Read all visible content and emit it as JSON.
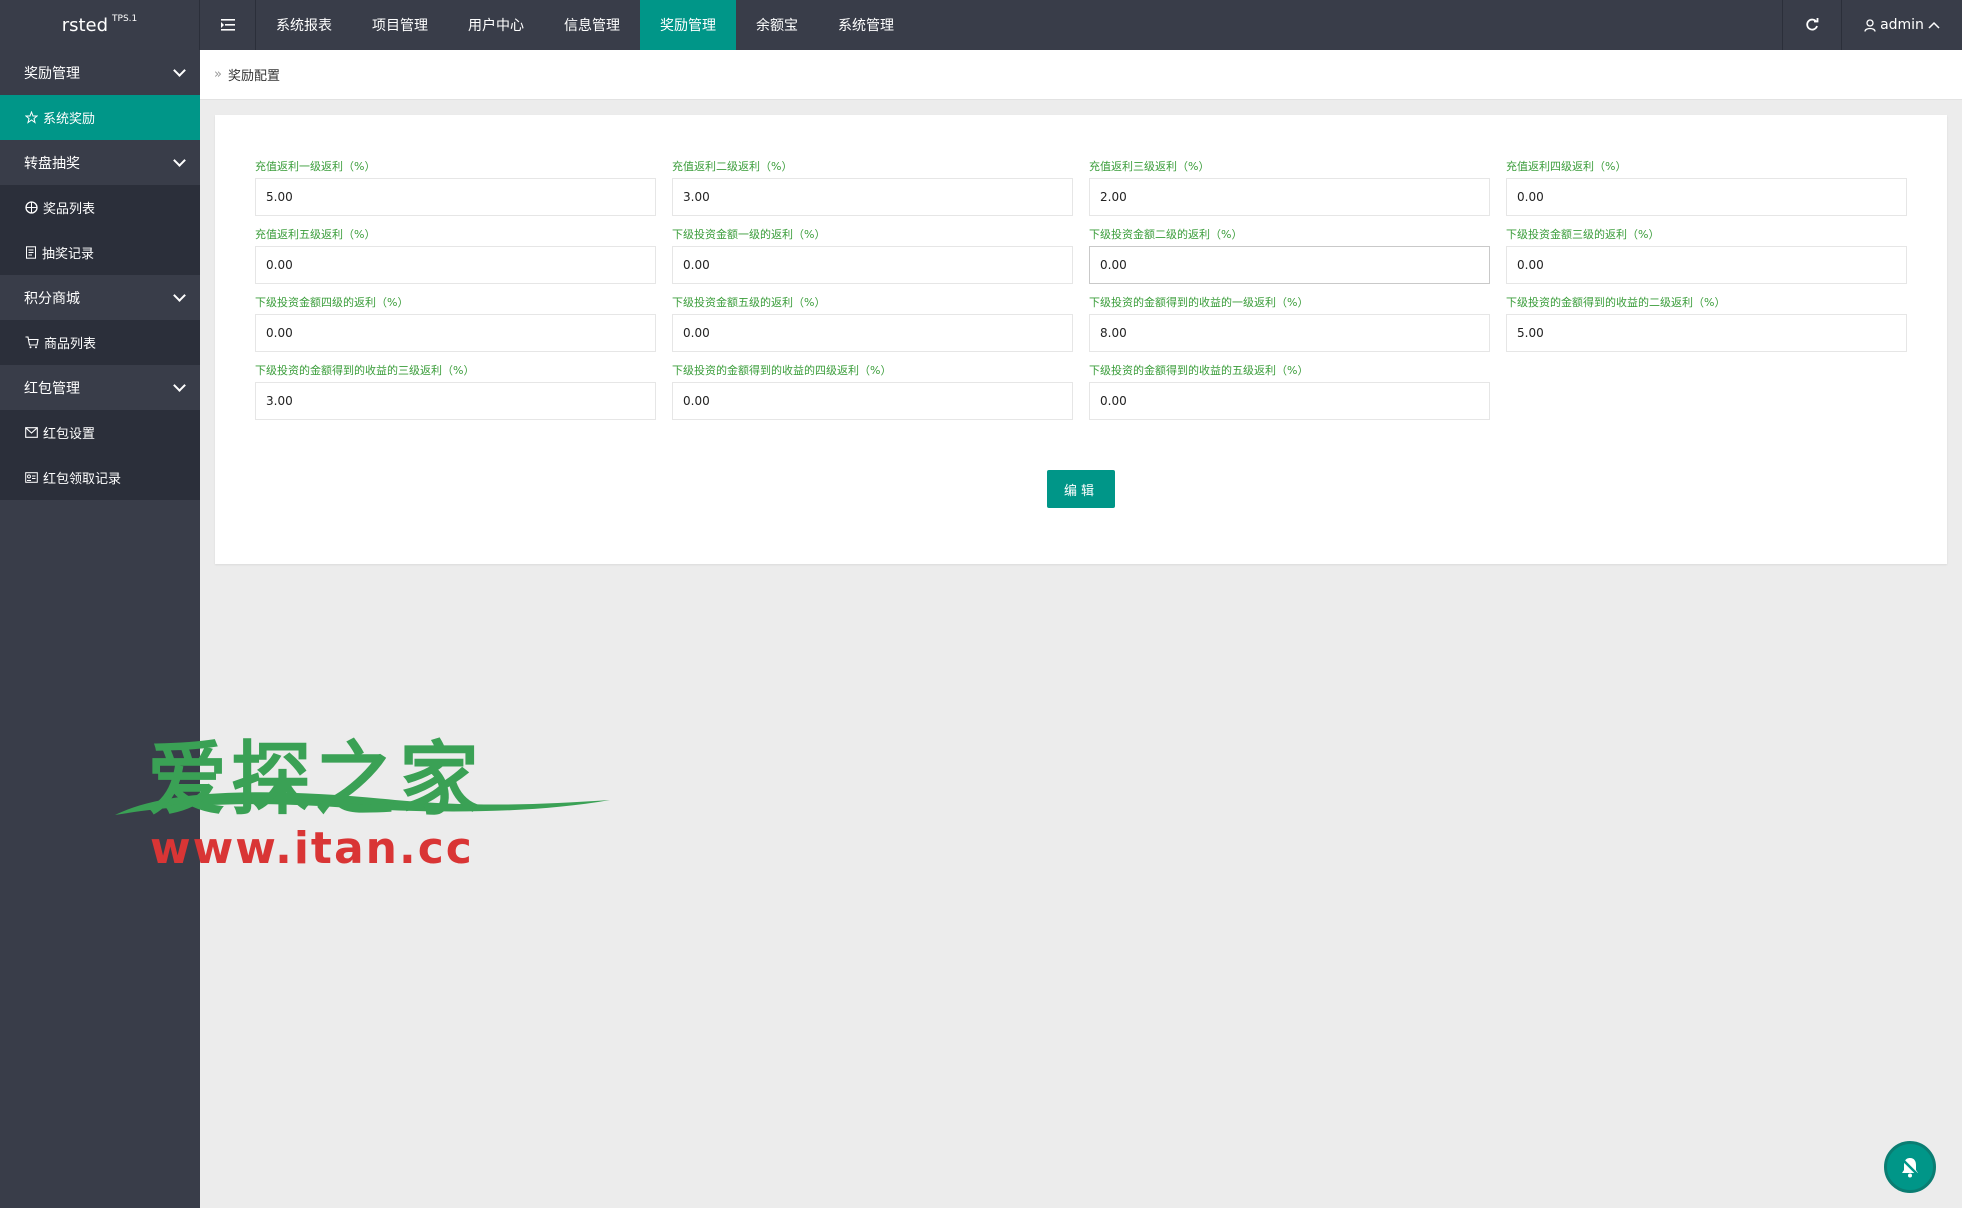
{
  "header": {
    "logo": "rsted",
    "logo_sup": "TPS.1",
    "nav": [
      {
        "label": "系统报表",
        "active": false
      },
      {
        "label": "项目管理",
        "active": false
      },
      {
        "label": "用户中心",
        "active": false
      },
      {
        "label": "信息管理",
        "active": false
      },
      {
        "label": "奖励管理",
        "active": true
      },
      {
        "label": "余额宝",
        "active": false
      },
      {
        "label": "系统管理",
        "active": false
      }
    ],
    "user": "admin"
  },
  "sidebar": {
    "groups": [
      {
        "label": "奖励管理",
        "items": [
          {
            "label": "系统奖励",
            "icon": "star-icon",
            "active": true
          }
        ]
      },
      {
        "label": "转盘抽奖",
        "items": [
          {
            "label": "奖品列表",
            "icon": "globe-icon",
            "active": false
          },
          {
            "label": "抽奖记录",
            "icon": "document-icon",
            "active": false
          }
        ]
      },
      {
        "label": "积分商城",
        "items": [
          {
            "label": "商品列表",
            "icon": "cart-icon",
            "active": false
          }
        ]
      },
      {
        "label": "红包管理",
        "items": [
          {
            "label": "红包设置",
            "icon": "envelope-icon",
            "active": false
          },
          {
            "label": "红包领取记录",
            "icon": "card-icon",
            "active": false
          }
        ]
      }
    ]
  },
  "breadcrumb": {
    "label": "奖励配置"
  },
  "form": {
    "fields": [
      {
        "label": "充值返利一级返利（%）",
        "value": "5.00"
      },
      {
        "label": "充值返利二级返利（%）",
        "value": "3.00"
      },
      {
        "label": "充值返利三级返利（%）",
        "value": "2.00"
      },
      {
        "label": "充值返利四级返利（%）",
        "value": "0.00"
      },
      {
        "label": "充值返利五级返利（%）",
        "value": "0.00"
      },
      {
        "label": "下级投资金额一级的返利（%）",
        "value": "0.00"
      },
      {
        "label": "下级投资金额二级的返利（%）",
        "value": "0.00"
      },
      {
        "label": "下级投资金额三级的返利（%）",
        "value": "0.00"
      },
      {
        "label": "下级投资金额四级的返利（%）",
        "value": "0.00"
      },
      {
        "label": "下级投资金额五级的返利（%）",
        "value": "0.00"
      },
      {
        "label": "下级投资的金额得到的收益的一级返利（%）",
        "value": "8.00"
      },
      {
        "label": "下级投资的金额得到的收益的二级返利（%）",
        "value": "5.00"
      },
      {
        "label": "下级投资的金额得到的收益的三级返利（%）",
        "value": "3.00"
      },
      {
        "label": "下级投资的金额得到的收益的四级返利（%）",
        "value": "0.00"
      },
      {
        "label": "下级投资的金额得到的收益的五级返利（%）",
        "value": "0.00"
      }
    ],
    "edit_label": "编辑"
  },
  "watermark": {
    "zh": "爱探之家",
    "en": "www.itan.cc"
  },
  "colors": {
    "accent": "#009688",
    "topbar": "#393d49",
    "sidebar_sub": "#2b2f3a",
    "label_green": "#3a9d3a"
  }
}
